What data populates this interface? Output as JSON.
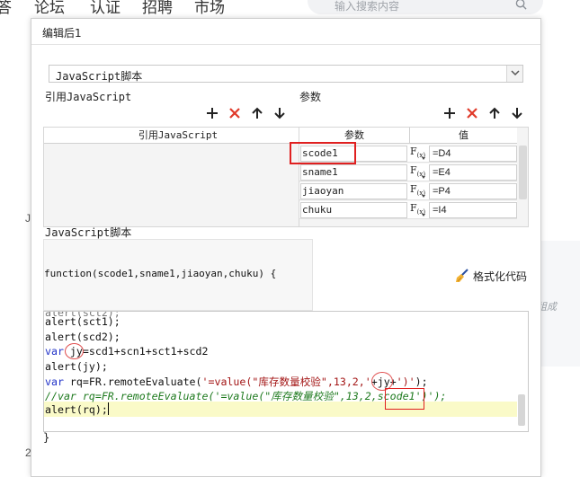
{
  "background": {
    "nav": [
      "答",
      "论坛",
      "认证",
      "招聘",
      "市场"
    ],
    "search_placeholder": "输入搜索内容",
    "side_text": "组成",
    "left_j": "J",
    "left_2": "2"
  },
  "dialog": {
    "title": "编辑后1",
    "script_type": "JavaScript脚本",
    "ref_label": "引用JavaScript",
    "params_label": "参数",
    "ref_table_header": "引用JavaScript",
    "params_headers": {
      "name": "参数",
      "value": "值"
    },
    "params": [
      {
        "name": "scode1",
        "fx": "F(x)",
        "value": "=D4"
      },
      {
        "name": "sname1",
        "fx": "F(x)",
        "value": "=E4"
      },
      {
        "name": "jiaoyan",
        "fx": "F(x)",
        "value": "=P4"
      },
      {
        "name": "chuku",
        "fx": "F(x)",
        "value": "=I4"
      }
    ],
    "script_label": "JavaScript脚本",
    "signature": "function(scode1,sname1,jiaoyan,chuku) {",
    "format_button": "格式化代码",
    "code": {
      "line0": "alert(sct1);",
      "line1": "alert(scd2);",
      "line2_kw": "var",
      "line2_rest": " jy=scd1+scn1+sct1+scd2",
      "line3": "alert(jy);",
      "line4_kw": "var",
      "line4_a": " rq=FR.remoteEvaluate(",
      "line4_str": "'=value(\"库存数量校验\",13,2,'",
      "line4_b": "+jy+",
      "line4_str2": "')'",
      "line4_c": ");",
      "line5": "//var rq=FR.remoteEvaluate('=value(\"库存数量校验\",13,2,scode1')');",
      "line6": "alert(rq);"
    },
    "closing_brace": "}"
  },
  "colors": {
    "annotation_red": "#e02020",
    "keyword_blue": "#2233c8",
    "comment_green": "#1e7a1e",
    "delete_red": "#e03a2a"
  }
}
